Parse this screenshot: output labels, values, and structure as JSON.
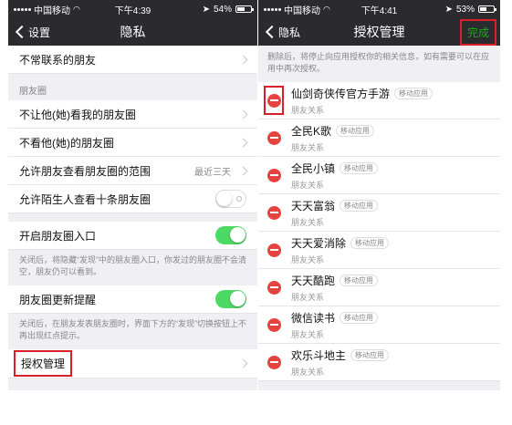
{
  "left": {
    "status": {
      "carrier": "中国移动",
      "time": "下午4:39",
      "battery": "54%",
      "battery_level": 0.54
    },
    "nav": {
      "back_label": "设置",
      "title": "隐私"
    },
    "rows": {
      "not_contacted": "不常联系的朋友",
      "moments_section": "朋友圈",
      "hide_my_moments": "不让他(她)看我的朋友圈",
      "hide_their_moments": "不看他(她)的朋友圈",
      "moments_range": "允许朋友查看朋友圈的范围",
      "moments_range_value": "最近三天",
      "stranger_ten": "允许陌生人查看十条朋友圈",
      "moments_entry": "开启朋友圈入口",
      "moments_entry_note": "关闭后，将隐藏“发现”中的朋友圈入口，你发过的朋友圈不会清空，朋友仍可以看到。",
      "moments_update": "朋友圈更新提醒",
      "moments_update_note": "关闭后，在朋友发表朋友圈时，界面下方的“发现”切换按钮上不再出现红点提示。",
      "auth_manage": "授权管理"
    },
    "switches": {
      "stranger_ten": false,
      "moments_entry": true,
      "moments_update": true
    }
  },
  "right": {
    "status": {
      "carrier": "中国移动",
      "time": "下午4:41",
      "battery": "53%",
      "battery_level": 0.53
    },
    "nav": {
      "back_label": "隐私",
      "title": "授权管理",
      "done_label": "完成"
    },
    "description": "删除后，将停止向应用授权你的相关信息，如有需要可以在应用中再次授权。",
    "apps": [
      {
        "name": "仙剑奇侠传官方手游",
        "tag": "移动应用",
        "sub": "朋友关系"
      },
      {
        "name": "全民K歌",
        "tag": "移动应用",
        "sub": "朋友关系"
      },
      {
        "name": "全民小镇",
        "tag": "移动应用",
        "sub": "朋友关系"
      },
      {
        "name": "天天富翁",
        "tag": "移动应用",
        "sub": "朋友关系"
      },
      {
        "name": "天天爱消除",
        "tag": "移动应用",
        "sub": "朋友关系"
      },
      {
        "name": "天天酷跑",
        "tag": "移动应用",
        "sub": "朋友关系"
      },
      {
        "name": "微信读书",
        "tag": "移动应用",
        "sub": "朋友关系"
      },
      {
        "name": "欢乐斗地主",
        "tag": "移动应用",
        "sub": "朋友关系"
      }
    ]
  },
  "colors": {
    "nav_bg": "#2b2b2f",
    "accent_green": "#1aad19",
    "switch_on": "#4cd964",
    "delete_red": "#e64340",
    "highlight_red": "#d9202a"
  }
}
